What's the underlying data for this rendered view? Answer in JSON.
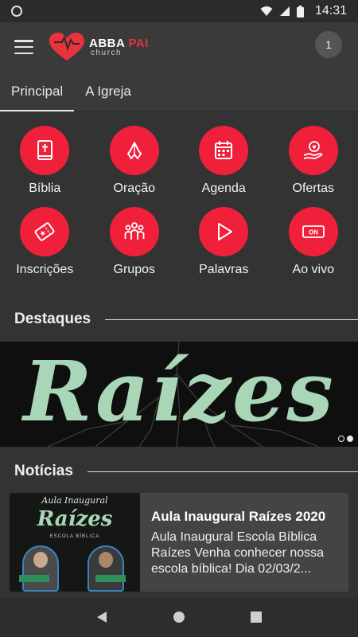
{
  "status_bar": {
    "time": "14:31"
  },
  "header": {
    "brand_main": "ABBA",
    "brand_accent": "PAI",
    "brand_sub": "church",
    "notification_count": "1",
    "brand_color": "#f0203a"
  },
  "tabs": [
    {
      "label": "Principal",
      "active": true
    },
    {
      "label": "A Igreja",
      "active": false
    }
  ],
  "shortcuts": [
    {
      "label": "Bíblia",
      "icon": "bible-icon"
    },
    {
      "label": "Oração",
      "icon": "praying-hands-icon"
    },
    {
      "label": "Agenda",
      "icon": "calendar-icon"
    },
    {
      "label": "Ofertas",
      "icon": "heart-hand-icon"
    },
    {
      "label": "Inscrições",
      "icon": "ticket-icon"
    },
    {
      "label": "Grupos",
      "icon": "group-icon"
    },
    {
      "label": "Palavras",
      "icon": "play-icon"
    },
    {
      "label": "Ao vivo",
      "icon": "on-air-icon",
      "badge_text": "ON"
    }
  ],
  "highlights": {
    "title": "Destaques",
    "banner_text": "Raízes",
    "slides": 2,
    "active_slide": 2
  },
  "news": {
    "title": "Notícias",
    "items": [
      {
        "thumb_top": "Aula Inaugural",
        "thumb_title": "Raízes",
        "thumb_sub": "ESCOLA BÍBLICA",
        "title": "Aula Inaugural Raízes 2020",
        "description": "Aula Inaugural Escola Bíblica Raízes Venha conhecer nossa escola bíblica! Dia 02/03/2..."
      }
    ]
  }
}
